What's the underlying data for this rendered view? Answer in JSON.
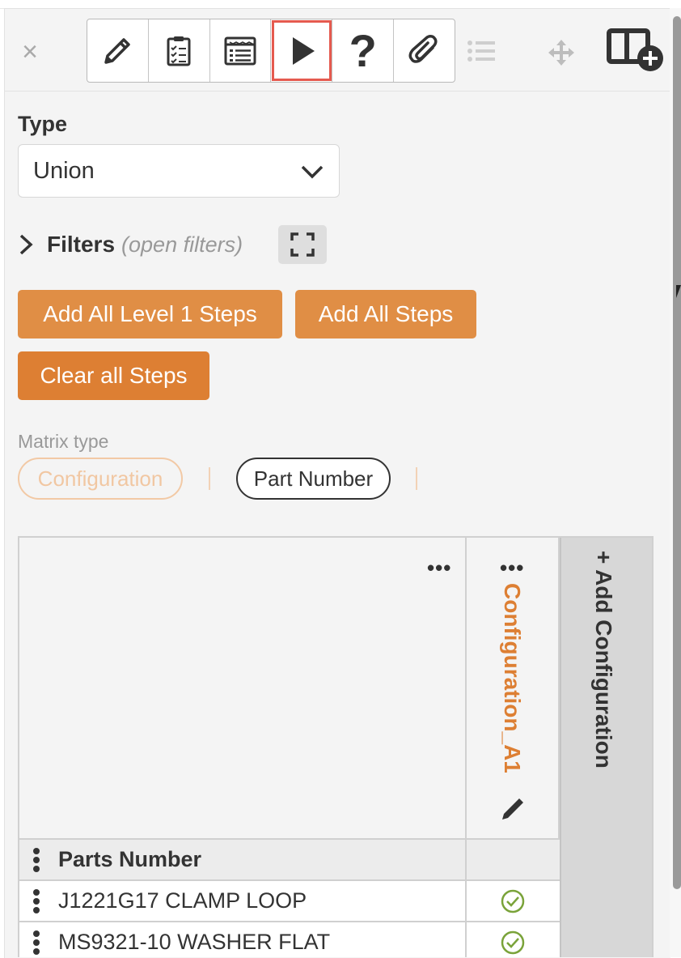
{
  "toolbar": {
    "close_symbol": "×",
    "tools": [
      {
        "name": "pencil-icon",
        "active": false
      },
      {
        "name": "clipboard-checklist-icon",
        "active": false
      },
      {
        "name": "form-list-icon",
        "active": false
      },
      {
        "name": "play-icon",
        "active": true
      },
      {
        "name": "help-icon",
        "label": "?",
        "active": false
      },
      {
        "name": "paperclip-icon",
        "active": false
      }
    ],
    "extra_icons": [
      "list-icon",
      "move-icon",
      "add-panel-icon"
    ]
  },
  "type_field": {
    "label": "Type",
    "value": "Union"
  },
  "filters": {
    "label": "Filters",
    "hint": "(open filters)"
  },
  "actions": {
    "add_level1": "Add All Level 1 Steps",
    "add_all": "Add All Steps",
    "clear_all": "Clear all Steps"
  },
  "matrix_type": {
    "label": "Matrix type",
    "options": [
      "Configuration",
      "Part Number"
    ],
    "selected": "Part Number"
  },
  "matrix": {
    "corner_menu": "•••",
    "column_menu": "•••",
    "configuration_column": "Configuration_A1",
    "add_configuration": "+ Add Configuration",
    "row_header": "Parts Number",
    "rows": [
      {
        "name": "J1221G17 CLAMP LOOP",
        "checked": true
      },
      {
        "name": "MS9321-10 WASHER FLAT",
        "checked": true
      }
    ]
  },
  "colors": {
    "accent_orange": "#e08e45",
    "accent_orange_dark": "#dd7f33",
    "active_outline": "#e55a4f",
    "check_green": "#7aa33a"
  }
}
